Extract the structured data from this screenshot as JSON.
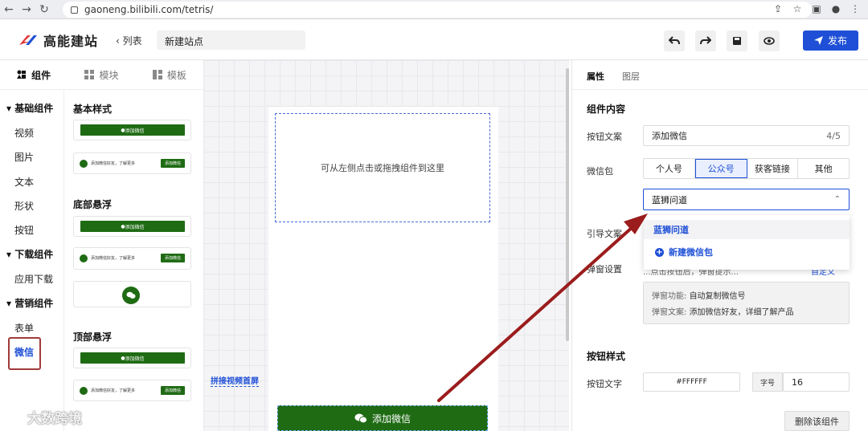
{
  "browser": {
    "url": "gaoneng.bilibili.com/tetris/"
  },
  "header": {
    "brand": "高能建站",
    "back_label": "列表",
    "site_name": "新建站点",
    "publish_label": "发布"
  },
  "left_tabs": [
    {
      "label": "组件",
      "active": true
    },
    {
      "label": "模块",
      "active": false
    },
    {
      "label": "模板",
      "active": false
    }
  ],
  "categories": {
    "group1": "基础组件",
    "group1_items": [
      "视频",
      "图片",
      "文本",
      "形状",
      "按钮"
    ],
    "group2": "下载组件",
    "group2_items": [
      "应用下载"
    ],
    "group3": "营销组件",
    "group3_items": [
      "表单",
      "微信"
    ]
  },
  "widgets": {
    "sec1": "基本样式",
    "sec2": "底部悬浮",
    "sec3": "顶部悬浮",
    "bar_label": "添加微信",
    "row_text": "添加微信好友，了解更多",
    "row_btn": "添加微信"
  },
  "canvas": {
    "dropzone_text": "可从左侧点击或拖拽组件到这里",
    "bottom_button": "添加微信",
    "video_link": "拼接视频首屏"
  },
  "watermark": "大数跨境",
  "right_panel": {
    "tabs": [
      "属性",
      "图层"
    ],
    "section_content": "组件内容",
    "btn_text_label": "按钮文案",
    "btn_text_value": "添加微信",
    "btn_text_count": "4/5",
    "wechat_label": "微信包",
    "wechat_options": [
      "个人号",
      "公众号",
      "获客链接",
      "其他"
    ],
    "select_value": "蓝狮问道",
    "dropdown_option1": "蓝狮问道",
    "dropdown_option2": "新建微信包",
    "guide_label": "引导文案",
    "popup_label": "弹窗设置",
    "popup_hidden_text": "...点击按钮后，弹窗提示...",
    "popup_link": "自定义",
    "info_func_key": "弹窗功能:",
    "info_func_val": "自动复制微信号",
    "info_text_key": "弹窗文案:",
    "info_text_val": "添加微信好友，详细了解产品",
    "section_style": "按钮样式",
    "btn_font_label": "按钮文字",
    "btn_font_color": "#FFFFFF",
    "font_size_label": "字号",
    "font_size_value": "16",
    "delete_label": "删除该组件"
  },
  "colors": {
    "accent": "#1e4fd6",
    "wechat_green": "#1f6b14",
    "arrow": "#9b1c1c"
  }
}
